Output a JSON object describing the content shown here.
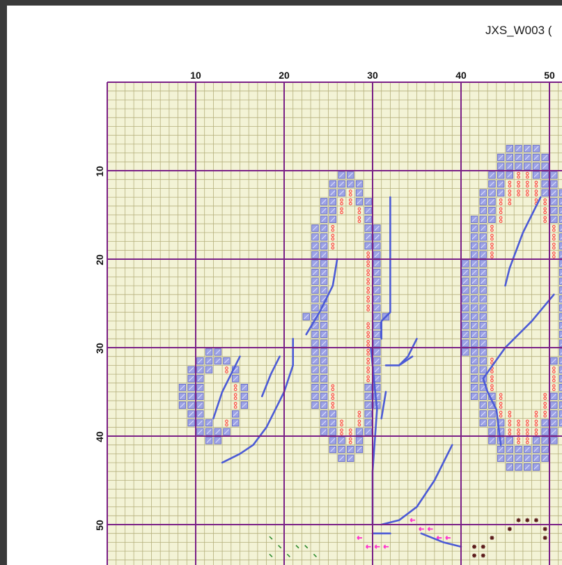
{
  "header": {
    "title": "JXS_W003 ("
  },
  "grid": {
    "top_labels": [
      "10",
      "20",
      "30",
      "40",
      "50"
    ],
    "side_labels": [
      "10",
      "20",
      "30",
      "40",
      "50"
    ]
  },
  "colors": {
    "page_background": "#ffffff",
    "window_frame": "#3a3a3a",
    "fabric": "#f3f3d6",
    "minor_grid": "#b5b07c",
    "major_grid": "#7a1f86",
    "symbol_blue": "#9da3e6",
    "symbol_red_dots": "#ff3333",
    "backstitch": "#4b5ad6",
    "symbol_magenta": "#ff33cc",
    "symbol_dark": "#5a1a1a",
    "symbol_green": "#2e8b2e"
  },
  "icons": {
    "blue": "filled-square-symbol",
    "red": "dot-pair-symbol",
    "magenta": "arrow-left-symbol",
    "dark": "asterisk-symbol",
    "green": "tick-symbol"
  }
}
